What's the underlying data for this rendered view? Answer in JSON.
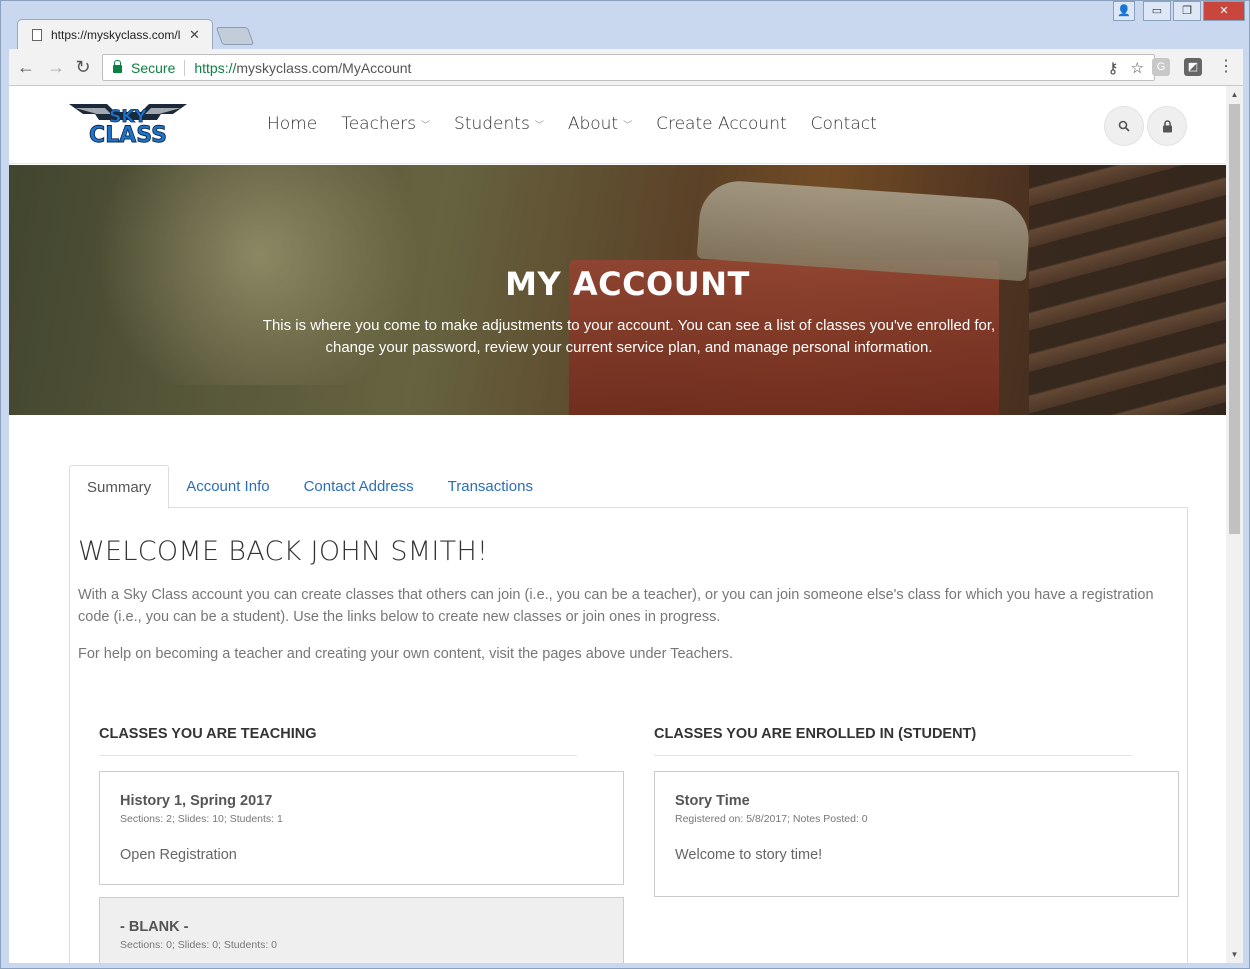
{
  "browser": {
    "tab_title": "https://myskyclass.com/l",
    "secure_label": "Secure",
    "url_scheme": "https://",
    "url_host": "myskyclass.com",
    "url_path": "/MyAccount",
    "extension_label": "G"
  },
  "site": {
    "logo_line1": "SKY",
    "logo_line2": "CLASS",
    "nav": {
      "home": "Home",
      "teachers": "Teachers",
      "students": "Students",
      "about": "About",
      "create_account": "Create Account",
      "contact": "Contact"
    }
  },
  "hero": {
    "title": "MY ACCOUNT",
    "text": "This is where you come to make adjustments to your account. You can see a list of classes you've enrolled for, change your password, review your current service plan, and manage personal information."
  },
  "tabs": {
    "summary": "Summary",
    "account_info": "Account Info",
    "contact_address": "Contact Address",
    "transactions": "Transactions"
  },
  "summary": {
    "welcome": "WELCOME BACK JOHN SMITH!",
    "para1": "With a Sky Class account you can create classes that others can join (i.e., you can be a teacher), or you can join someone else's class for which you have a registration code (i.e., you can be a student). Use the links below to create new classes or join ones in progress.",
    "para2": "For help on becoming a teacher and creating your own content, visit the pages above under Teachers."
  },
  "teaching": {
    "heading": "CLASSES YOU ARE TEACHING",
    "classes": [
      {
        "title": "History 1, Spring 2017",
        "meta": "Sections: 2; Slides: 10; Students: 1",
        "desc": "Open Registration"
      },
      {
        "title": "- BLANK -",
        "meta": "Sections: 0; Slides: 0; Students: 0",
        "desc": ""
      }
    ]
  },
  "enrolled": {
    "heading": "CLASSES YOU ARE ENROLLED IN (STUDENT)",
    "classes": [
      {
        "title": "Story Time",
        "meta": "Registered on: 5/8/2017; Notes Posted: 0",
        "desc": "Welcome to story time!"
      }
    ]
  },
  "colors": {
    "link": "#2a6ebb",
    "secure_green": "#0b8043",
    "logo_blue": "#1f74c9"
  }
}
